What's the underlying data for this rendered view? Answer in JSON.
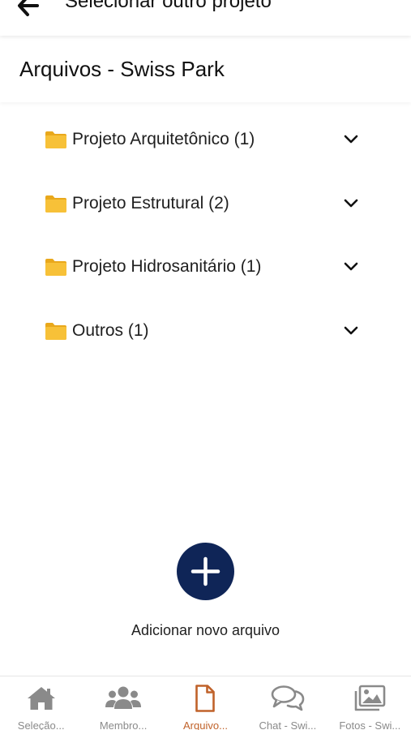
{
  "header": {
    "title": "Selecionar outro projeto",
    "back_icon": "arrow-left-icon"
  },
  "section": {
    "heading": "Arquivos - Swiss Park"
  },
  "folders": [
    {
      "label": "Projeto Arquitetônico (1)",
      "icon": "folder-icon",
      "expand_icon": "chevron-down-icon"
    },
    {
      "label": "Projeto Estrutural (2)",
      "icon": "folder-icon",
      "expand_icon": "chevron-down-icon"
    },
    {
      "label": "Projeto Hidrosanitário (1)",
      "icon": "folder-icon",
      "expand_icon": "chevron-down-icon"
    },
    {
      "label": "Outros (1)",
      "icon": "folder-icon",
      "expand_icon": "chevron-down-icon"
    }
  ],
  "add_file": {
    "icon": "plus-icon",
    "label": "Adicionar novo arquivo"
  },
  "bottom_nav": {
    "items": [
      {
        "label": "Seleção...",
        "icon": "home-icon",
        "active": false
      },
      {
        "label": "Membro...",
        "icon": "users-icon",
        "active": false
      },
      {
        "label": "Arquivo...",
        "icon": "file-icon",
        "active": true
      },
      {
        "label": "Chat - Swi...",
        "icon": "chat-icon",
        "active": false
      },
      {
        "label": "Fotos - Swi...",
        "icon": "photos-icon",
        "active": false
      }
    ]
  },
  "colors": {
    "accent": "#c0622a",
    "fab": "#0f2557",
    "inactive": "#8a8a8a",
    "folder": "#f5b82e"
  }
}
